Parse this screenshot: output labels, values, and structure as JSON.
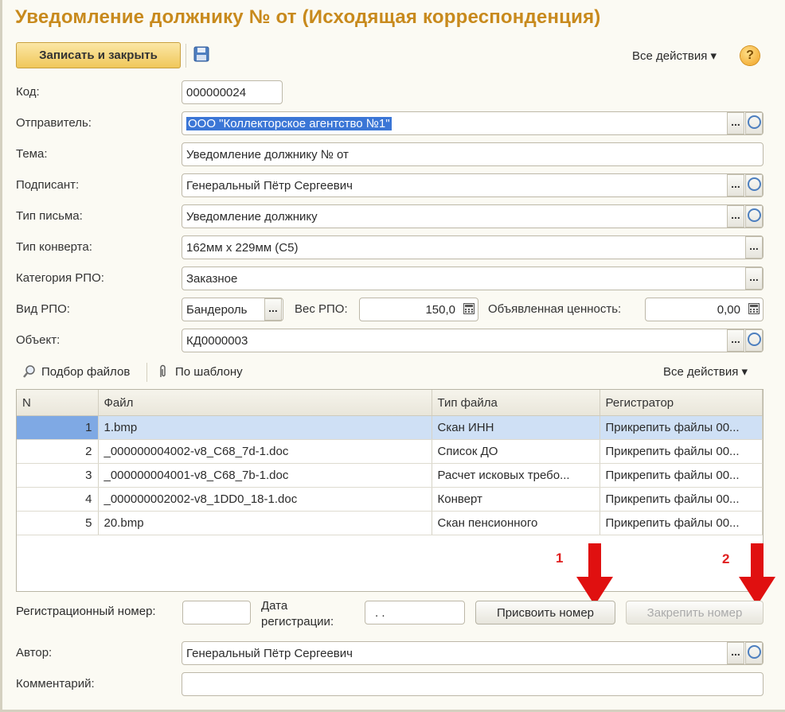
{
  "window": {
    "title": "Уведомление должнику №  от (Исходящая корреспонденция)"
  },
  "toolbar": {
    "save_close_label": "Записать и закрыть",
    "all_actions_label": "Все действия ▾",
    "help_icon": "?"
  },
  "fields": {
    "code": {
      "label": "Код:",
      "value": "000000024"
    },
    "sender": {
      "label": "Отправитель:",
      "value": "ООО \"Коллекторское агентство №1\""
    },
    "subject": {
      "label": "Тема:",
      "value": "Уведомление должнику №  от"
    },
    "signer": {
      "label": "Подписант:",
      "value": "Генеральный Пётр Сергеевич"
    },
    "letter_type": {
      "label": "Тип письма:",
      "value": "Уведомление должнику"
    },
    "envelope_type": {
      "label": "Тип конверта:",
      "value": "162мм х 229мм (C5)"
    },
    "rpo_category": {
      "label": "Категория РПО:",
      "value": "Заказное"
    },
    "rpo_kind": {
      "label": "Вид РПО:",
      "value": "Бандероль"
    },
    "rpo_weight": {
      "label": "Вес РПО:",
      "value": "150,0"
    },
    "declared_value": {
      "label": "Объявленная ценность:",
      "value": "0,00"
    },
    "object": {
      "label": "Объект:",
      "value": "КД0000003"
    },
    "author": {
      "label": "Автор:",
      "value": "Генеральный Пётр Сергеевич"
    },
    "comment": {
      "label": "Комментарий:",
      "value": ""
    },
    "reg_number": {
      "label": "Регистрационный номер:",
      "value": ""
    },
    "reg_date": {
      "label_line1": "Дата",
      "label_line2": "регистрации:",
      "value": ". ."
    }
  },
  "files_toolbar": {
    "pick_files": "Подбор файлов",
    "by_template": "По шаблону",
    "all_actions": "Все действия ▾"
  },
  "files_table": {
    "columns": [
      "N",
      "Файл",
      "Тип файла",
      "Регистратор"
    ],
    "rows": [
      {
        "n": "1",
        "file": "1.bmp",
        "type": "Скан ИНН",
        "registrar": "Прикрепить файлы 00..."
      },
      {
        "n": "2",
        "file": "_000000004002-v8_C68_7d-1.doc",
        "type": "Список ДО",
        "registrar": "Прикрепить файлы 00..."
      },
      {
        "n": "3",
        "file": "_000000004001-v8_C68_7b-1.doc",
        "type": "Расчет исковых требо...",
        "registrar": "Прикрепить файлы 00..."
      },
      {
        "n": "4",
        "file": "_000000002002-v8_1DD0_18-1.doc",
        "type": "Конверт",
        "registrar": "Прикрепить файлы 00..."
      },
      {
        "n": "5",
        "file": "20.bmp",
        "type": "Скан пенсионного",
        "registrar": "Прикрепить файлы 00..."
      }
    ]
  },
  "buttons": {
    "assign_number": "Присвоить номер",
    "fix_number": "Закрепить номер"
  },
  "annotations": {
    "marker1": "1",
    "marker2": "2",
    "color": "#e02020"
  },
  "colors": {
    "title": "#c88a1d",
    "selection": "#3b76d6",
    "selected_row": "#cfe0f5"
  }
}
